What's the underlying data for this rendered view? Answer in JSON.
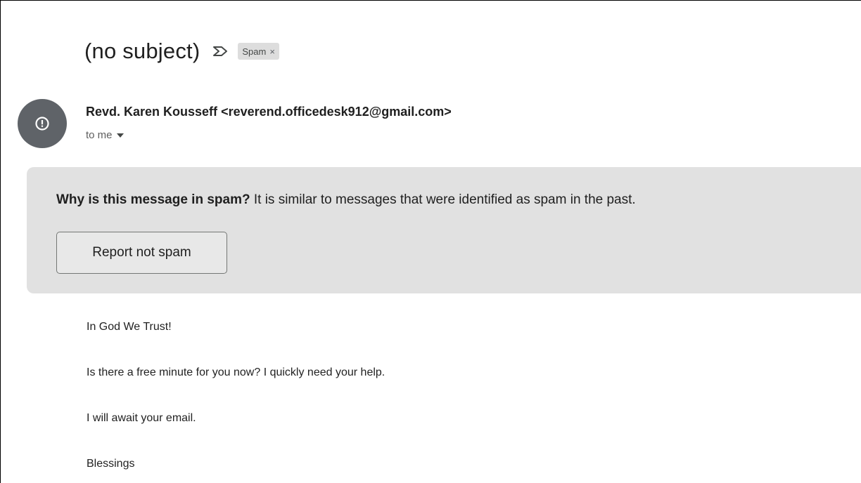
{
  "email": {
    "subject": "(no subject)",
    "label_chip": {
      "text": "Spam",
      "remove_glyph": "×"
    },
    "sender": {
      "name": "Revd. Karen Kousseff",
      "email_display": "<reverend.officedesk912@gmail.com>",
      "avatar_icon": "exclamation-circle-icon",
      "avatar_color": "#5f6368"
    },
    "recipient_text": "to me",
    "spam_banner": {
      "question": "Why is this message in spam?",
      "explanation": " It is similar to messages that were identified as spam in the past.",
      "button_label": "Report not spam",
      "background": "#e1e1e1"
    },
    "body_lines": [
      "In God We Trust!",
      "Is there a free minute for you now? I quickly need your help.",
      "I will await your email.",
      "Blessings"
    ]
  }
}
